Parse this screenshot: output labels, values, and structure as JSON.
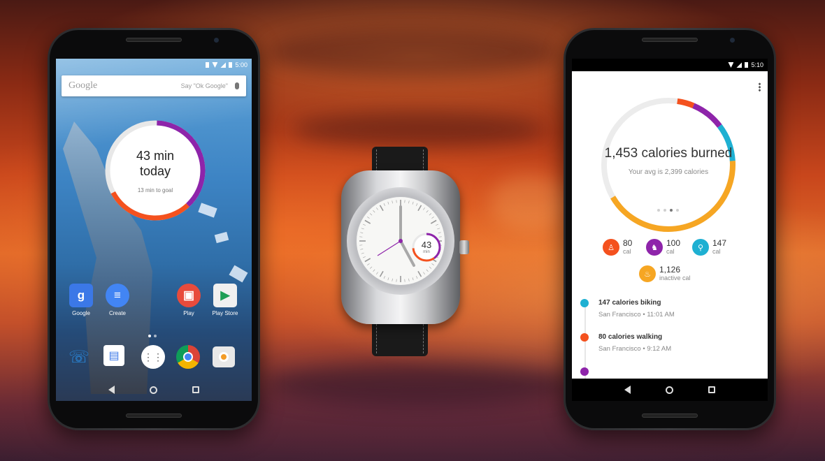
{
  "left_phone": {
    "status": {
      "time": "5:00"
    },
    "search": {
      "brand": "Google",
      "hint": "Say \"Ok Google\""
    },
    "widget": {
      "line1": "43 min",
      "line2": "today",
      "sub": "13 min to goal"
    },
    "apps": [
      {
        "label": "Google",
        "icon": "google-search-icon",
        "color": "#3b78e7"
      },
      {
        "label": "Create",
        "icon": "docs-icon",
        "color": "#4285f4"
      },
      {
        "label": "Play",
        "icon": "play-icon",
        "color": "#e84b3c"
      },
      {
        "label": "Play Store",
        "icon": "play-store-icon",
        "color": "#f0f0f0"
      }
    ],
    "dock": [
      "phone-icon",
      "messenger-icon",
      "app-drawer-icon",
      "chrome-icon",
      "camera-icon"
    ]
  },
  "watch": {
    "value": "43",
    "unit": "min"
  },
  "right_phone": {
    "status": {
      "time": "5:10"
    },
    "summary": {
      "title": "1,453 calories burned",
      "subtitle": "Your avg is 2,399 calories"
    },
    "stats": [
      {
        "value": "80",
        "unit": "cal",
        "icon": "walking-icon",
        "color": "#f4511e"
      },
      {
        "value": "100",
        "unit": "cal",
        "icon": "running-icon",
        "color": "#8e24aa"
      },
      {
        "value": "147",
        "unit": "cal",
        "icon": "biking-icon",
        "color": "#1eb0d2"
      },
      {
        "value": "1,126",
        "unit": "inactive cal",
        "icon": "flame-icon",
        "color": "#f6a623"
      }
    ],
    "timeline": [
      {
        "title": "147 calories biking",
        "sub": "San Francisco • 11:01 AM",
        "color": "#1eb0d2"
      },
      {
        "title": "80 calories walking",
        "sub": "San Francisco • 9:12 AM",
        "color": "#f4511e"
      }
    ]
  },
  "colors": {
    "orange": "#f6a623",
    "purple": "#8e24aa",
    "red": "#f4511e",
    "cyan": "#1eb0d2",
    "track": "#e8e8e8"
  }
}
